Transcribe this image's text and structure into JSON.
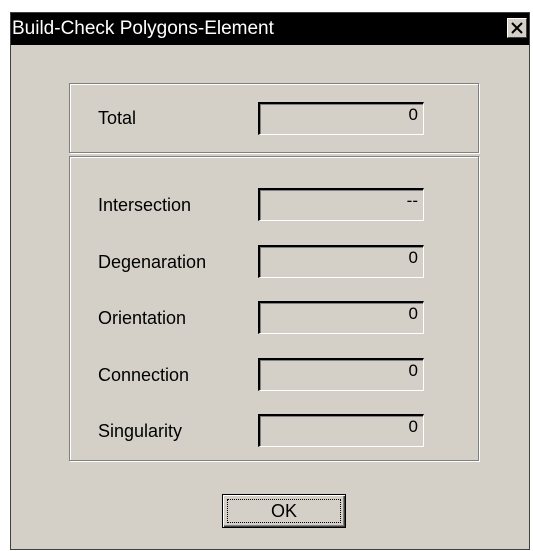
{
  "window": {
    "title": "Build-Check Polygons-Element",
    "close_icon": "close-icon"
  },
  "total": {
    "label": "Total",
    "value": "0"
  },
  "checks": [
    {
      "label": "Intersection",
      "value": "--"
    },
    {
      "label": "Degenaration",
      "value": "0"
    },
    {
      "label": "Orientation",
      "value": "0"
    },
    {
      "label": "Connection",
      "value": "0"
    },
    {
      "label": "Singularity",
      "value": "0"
    }
  ],
  "buttons": {
    "ok_label": "OK"
  },
  "colors": {
    "face": "#d4d0c8",
    "titlebar": "#000000",
    "title_text": "#ffffff"
  }
}
